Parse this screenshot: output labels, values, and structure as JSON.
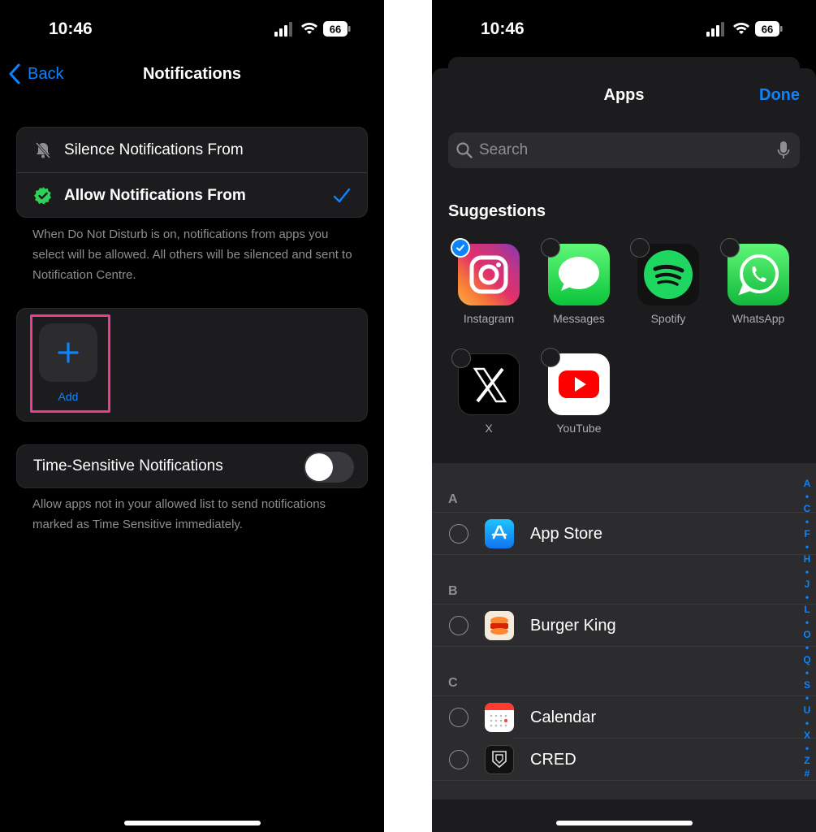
{
  "status": {
    "time": "10:46",
    "battery": "66"
  },
  "left": {
    "back_label": "Back",
    "title": "Notifications",
    "silence_label": "Silence Notifications From",
    "allow_label": "Allow Notifications From",
    "allow_note": "When Do Not Disturb is on, notifications from apps you select will be allowed. All others will be silenced and sent to Notification Centre.",
    "add_label": "Add",
    "time_sensitive_label": "Time-Sensitive Notifications",
    "time_sensitive_enabled": false,
    "time_sensitive_note": "Allow apps not in your allowed list to send notifications marked as Time Sensitive immediately."
  },
  "right": {
    "title": "Apps",
    "done_label": "Done",
    "search_placeholder": "Search",
    "suggestions_title": "Suggestions",
    "suggestions": [
      {
        "name": "Instagram",
        "selected": true
      },
      {
        "name": "Messages",
        "selected": false
      },
      {
        "name": "Spotify",
        "selected": false
      },
      {
        "name": "WhatsApp",
        "selected": false
      },
      {
        "name": "X",
        "selected": false
      },
      {
        "name": "YouTube",
        "selected": false
      }
    ],
    "sections": [
      {
        "letter": "A",
        "apps": [
          "App Store"
        ]
      },
      {
        "letter": "B",
        "apps": [
          "Burger King"
        ]
      },
      {
        "letter": "C",
        "apps": [
          "Calendar",
          "CRED"
        ]
      }
    ],
    "index": [
      "A",
      "•",
      "C",
      "•",
      "F",
      "•",
      "H",
      "•",
      "J",
      "•",
      "L",
      "•",
      "O",
      "•",
      "Q",
      "•",
      "S",
      "•",
      "U",
      "•",
      "X",
      "•",
      "Z",
      "#"
    ]
  },
  "colors": {
    "accent": "#0a84ff",
    "highlight": "#e83e8c",
    "allow_badge": "#30d158"
  }
}
